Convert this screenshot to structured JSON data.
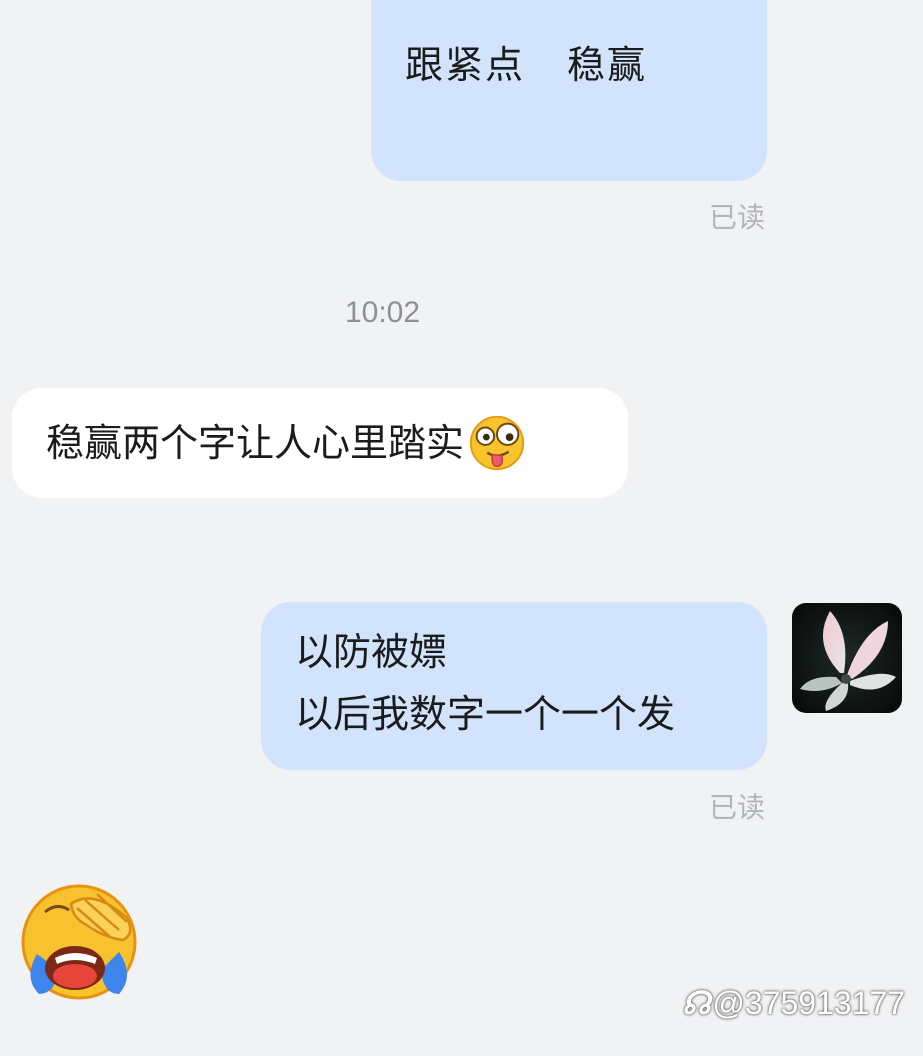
{
  "messages": {
    "m1": {
      "words": [
        "跟紧点",
        "稳赢"
      ],
      "status": "已读"
    },
    "time_separator": "10:02",
    "m2": {
      "text": "稳赢两个字让人心里踏实",
      "emoji": "silly-face-emoji"
    },
    "m3": {
      "lines": [
        "以防被嫖",
        "以后我数字一个一个发"
      ],
      "status": "已读"
    },
    "m4": {
      "emoji": "crying-face-covering-eyes-emoji"
    }
  },
  "avatar": {
    "icon": "lotus-flower-avatar"
  },
  "watermark": {
    "logo": "☊",
    "text": "@375913177"
  },
  "colors": {
    "outgoing_bubble": "#d2e4fd",
    "incoming_bubble": "#ffffff",
    "background": "#f1f2f4",
    "status_text": "#b3b5b9"
  }
}
